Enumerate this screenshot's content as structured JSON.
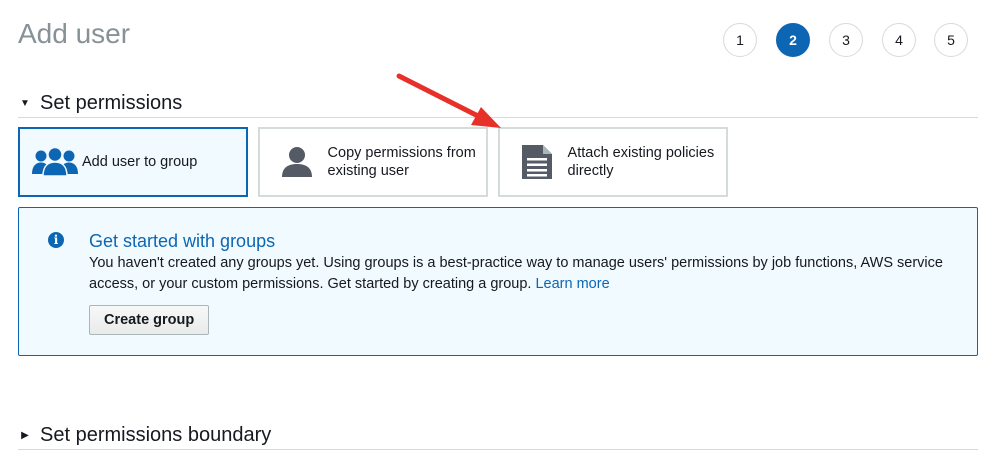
{
  "page": {
    "title": "Add user"
  },
  "steps": [
    {
      "label": "1",
      "active": false
    },
    {
      "label": "2",
      "active": true
    },
    {
      "label": "3",
      "active": false
    },
    {
      "label": "4",
      "active": false
    },
    {
      "label": "5",
      "active": false
    }
  ],
  "sections": {
    "permissions": {
      "label": "Set permissions",
      "expanded": true
    },
    "boundary": {
      "label": "Set permissions boundary",
      "expanded": false
    }
  },
  "options": [
    {
      "label": "Add user to group",
      "icon": "users-group-icon",
      "selected": true
    },
    {
      "label": "Copy permissions from existing user",
      "icon": "user-icon",
      "selected": false
    },
    {
      "label": "Attach existing policies directly",
      "icon": "document-icon",
      "selected": false
    }
  ],
  "info": {
    "title": "Get started with groups",
    "text": "You haven't created any groups yet. Using groups is a best-practice way to manage users' permissions by job functions, AWS service access, or your custom permissions. Get started by creating a group.",
    "link": "Learn more",
    "button": "Create group",
    "icon": "info-icon"
  },
  "colors": {
    "accent": "#0d66b3",
    "selected_bg": "#f1faff",
    "annotation": "#e8302a"
  }
}
